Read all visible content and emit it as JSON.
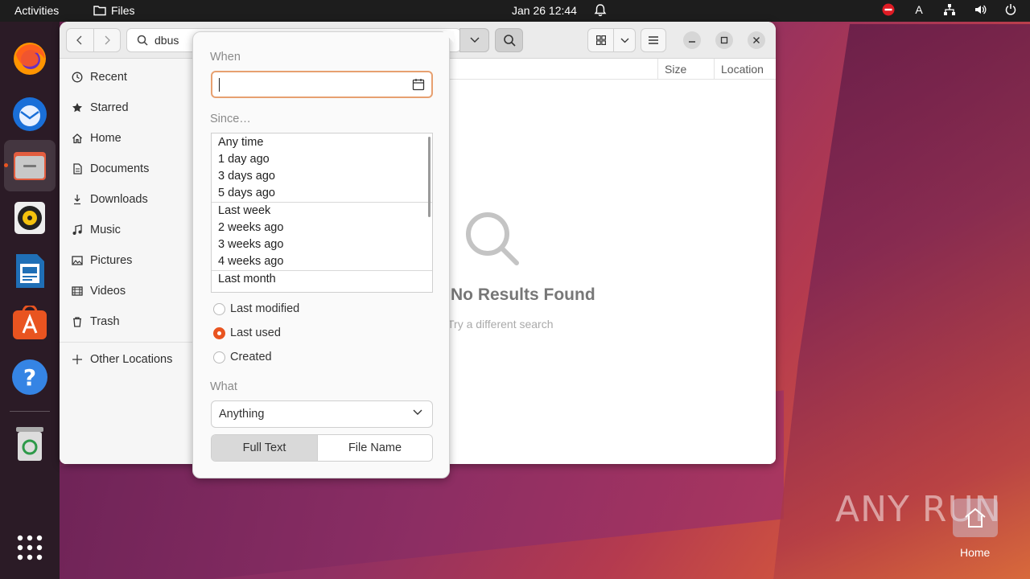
{
  "topbar": {
    "activities": "Activities",
    "app_name": "Files",
    "clock": "Jan 26  12:44",
    "input_indicator": "A"
  },
  "dock": {
    "items": [
      "firefox",
      "thunderbird",
      "files",
      "rhythmbox",
      "libreoffice-writer",
      "app-center",
      "help",
      "trash",
      "show-apps"
    ]
  },
  "window": {
    "search_query": "dbus",
    "columns": [
      "Size",
      "Location"
    ],
    "no_results_title": "No Results Found",
    "no_results_subtitle": "Try a different search"
  },
  "sidebar": {
    "items": [
      {
        "label": "Recent",
        "icon": "clock-icon"
      },
      {
        "label": "Starred",
        "icon": "star-icon"
      },
      {
        "label": "Home",
        "icon": "home-icon"
      },
      {
        "label": "Documents",
        "icon": "document-icon"
      },
      {
        "label": "Downloads",
        "icon": "download-icon"
      },
      {
        "label": "Music",
        "icon": "music-icon"
      },
      {
        "label": "Pictures",
        "icon": "picture-icon"
      },
      {
        "label": "Videos",
        "icon": "video-icon"
      },
      {
        "label": "Trash",
        "icon": "trash-icon"
      }
    ],
    "other_locations": "Other Locations"
  },
  "popover": {
    "when_label": "When",
    "date_value": "",
    "since_label": "Since…",
    "since_options": [
      "Any time",
      "1 day ago",
      "3 days ago",
      "5 days ago",
      "Last week",
      "2 weeks ago",
      "3 weeks ago",
      "4 weeks ago",
      "Last month"
    ],
    "radios": [
      {
        "label": "Last modified",
        "selected": false
      },
      {
        "label": "Last used",
        "selected": true
      },
      {
        "label": "Created",
        "selected": false
      }
    ],
    "what_label": "What",
    "what_value": "Anything",
    "search_modes": [
      "Full Text",
      "File Name"
    ],
    "active_mode": "Full Text"
  },
  "overlay": {
    "watermark": "ANY RUN",
    "desktop_home_label": "Home"
  },
  "colors": {
    "accent": "#e95420",
    "topbar": "#1d1d1d",
    "dock": "#2b1b26"
  }
}
